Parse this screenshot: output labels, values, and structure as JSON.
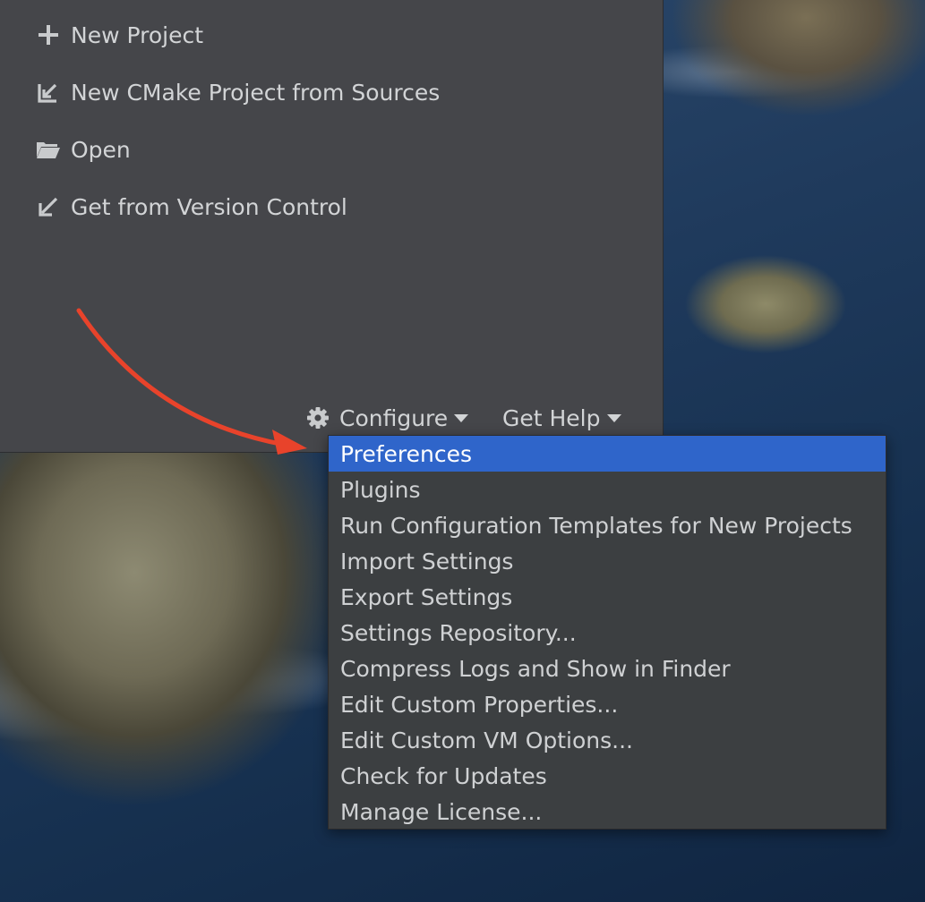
{
  "welcome": {
    "actions": [
      {
        "label": "New Project",
        "icon": "plus-icon"
      },
      {
        "label": "New CMake Project from Sources",
        "icon": "import-icon"
      },
      {
        "label": "Open",
        "icon": "folder-icon"
      },
      {
        "label": "Get from Version Control",
        "icon": "arrow-down-left-icon"
      }
    ],
    "configure_label": "Configure",
    "configure_icon": "gear-icon",
    "get_help_label": "Get Help"
  },
  "configure_menu": {
    "selected_index": 0,
    "items": [
      "Preferences",
      "Plugins",
      "Run Configuration Templates for New Projects",
      "Import Settings",
      "Export Settings",
      "Settings Repository...",
      "Compress Logs and Show in Finder",
      "Edit Custom Properties...",
      "Edit Custom VM Options...",
      "Check for Updates",
      "Manage License..."
    ]
  },
  "colors": {
    "panel_bg": "#45464a",
    "menu_bg": "#3c3f41",
    "selection": "#2f65ca",
    "text": "#d2d4d6",
    "annotation_arrow": "#e8432b"
  }
}
